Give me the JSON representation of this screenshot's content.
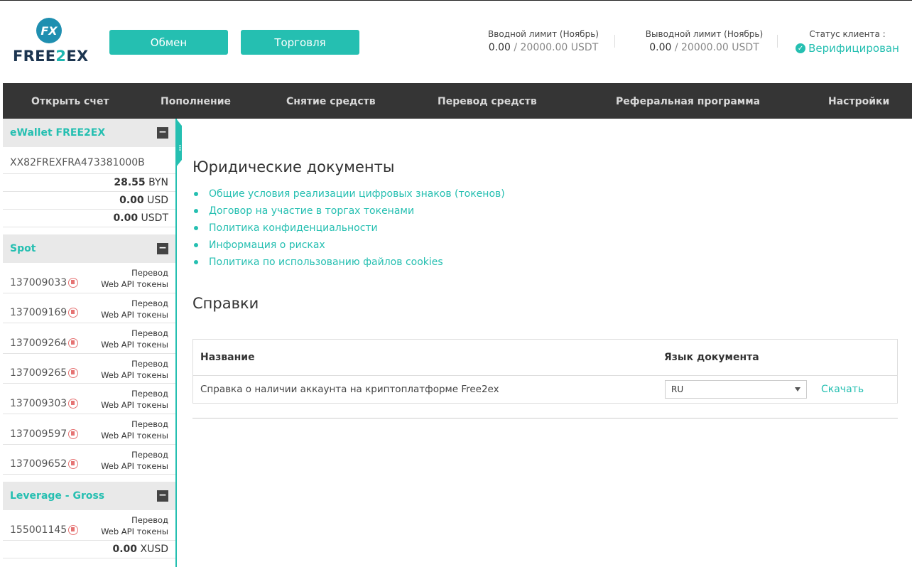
{
  "brand": {
    "logo_mark": "FX",
    "logo_text_a": "FREE",
    "logo_text_b": "2",
    "logo_text_c": "EX"
  },
  "header": {
    "exchange_label": "Обмен",
    "trade_label": "Торговля",
    "in_limit_label": "Вводной лимит (Ноябрь)",
    "in_limit_used": "0.00",
    "in_limit_max": "/ 20000.00 USDT",
    "out_limit_label": "Выводной лимит (Ноябрь)",
    "out_limit_used": "0.00",
    "out_limit_max": "/ 20000.00 USDT",
    "status_label": "Статус клиента :",
    "status_value": "Верифицирован"
  },
  "nav": [
    "Открыть счет",
    "Пополнение",
    "Снятие средств",
    "Перевод средств",
    "Реферальная программа",
    "Настройки"
  ],
  "sidebar": {
    "ewallet": {
      "title": "eWallet FREE2EX",
      "id": "XX82FREXFRA473381000B",
      "balances": [
        {
          "amount": "28.55",
          "currency": "BYN"
        },
        {
          "amount": "0.00",
          "currency": "USD"
        },
        {
          "amount": "0.00",
          "currency": "USDT"
        }
      ]
    },
    "spot": {
      "title": "Spot",
      "accounts": [
        "137009033",
        "137009169",
        "137009264",
        "137009265",
        "137009303",
        "137009597",
        "137009652"
      ]
    },
    "leverage": {
      "title": "Leverage - Gross",
      "accounts": [
        "155001145"
      ],
      "balance_amount": "0.00",
      "balance_currency": "XUSD"
    },
    "link_transfer": "Перевод",
    "link_api": "Web API токены",
    "collapse_symbol": "−"
  },
  "main": {
    "legal_title": "Юридические документы",
    "legal_docs": [
      "Общие условия реализации цифровых знаков (токенов)",
      "Договор на участие в торгах токенами",
      "Политика конфиденциальности",
      "Информация о рисках",
      "Политика по использованию файлов cookies"
    ],
    "refs_title": "Справки",
    "table": {
      "col_name": "Название",
      "col_lang": "Язык документа",
      "row_name": "Справка о наличии аккаунта на криптоплатформе Free2ex",
      "row_lang": "RU",
      "row_action": "Скачать"
    }
  }
}
